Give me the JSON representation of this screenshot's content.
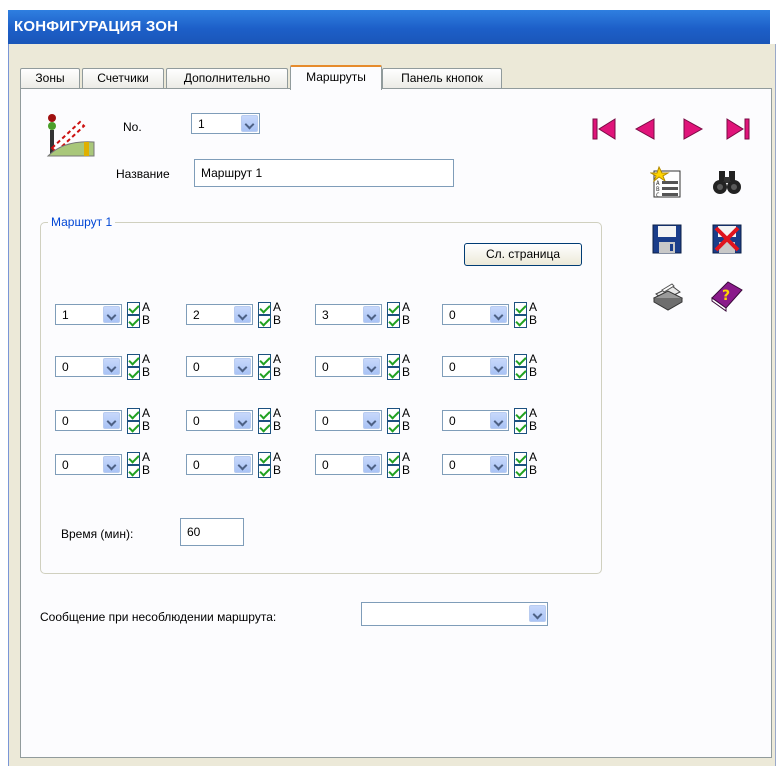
{
  "window": {
    "title": "КОНФИГУРАЦИЯ ЗОН"
  },
  "tabs": [
    {
      "label": "Зоны",
      "active": false
    },
    {
      "label": "Счетчики",
      "active": false
    },
    {
      "label": "Дополнительно",
      "active": false
    },
    {
      "label": "Маршруты",
      "active": true
    },
    {
      "label": "Панель кнопок",
      "active": false
    }
  ],
  "form": {
    "no_label": "No.",
    "no_value": "1",
    "name_label": "Название",
    "name_value": "Маршрут 1",
    "group_title": "Маршрут 1",
    "next_page_label": "Сл. страница",
    "time_label": "Время (мин):",
    "time_value": "60",
    "message_label": "Сообщение при несоблюдении маршрута:",
    "message_value": ""
  },
  "route_steps": {
    "check_a_label": "A",
    "check_b_label": "B",
    "rows": [
      [
        "1",
        "2",
        "3",
        "0"
      ],
      [
        "0",
        "0",
        "0",
        "0"
      ],
      [
        "0",
        "0",
        "0",
        "0"
      ],
      [
        "0",
        "0",
        "0",
        "0"
      ]
    ]
  },
  "toolbar": {
    "icons": [
      "first-record-icon",
      "previous-record-icon",
      "next-record-icon",
      "last-record-icon",
      "new-record-icon",
      "find-icon",
      "save-icon",
      "delete-icon",
      "print-icon",
      "help-icon"
    ]
  },
  "colors": {
    "titlebar": "#1d5fc8",
    "group_title": "#0046d5",
    "nav_arrows": "#e0147a",
    "tab_accent": "#e68b2c"
  }
}
